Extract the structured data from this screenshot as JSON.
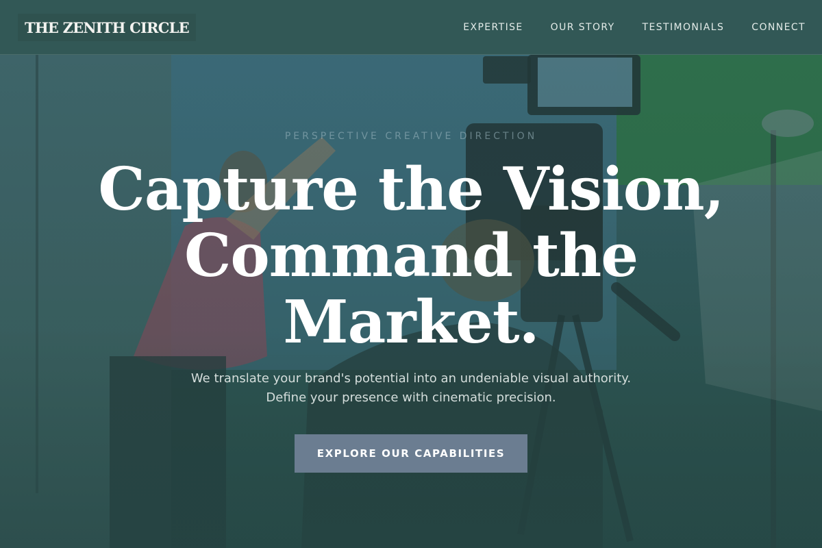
{
  "header": {
    "logo": "THE ZENITH CIRCLE",
    "nav": [
      {
        "label": "EXPERTISE"
      },
      {
        "label": "OUR STORY"
      },
      {
        "label": "TESTIMONIALS"
      },
      {
        "label": "CONNECT"
      }
    ]
  },
  "hero": {
    "eyebrow": "PERSPECTIVE CREATIVE DIRECTION",
    "headline": "Capture the Vision, Command the Market.",
    "subtext_line1": "We translate your brand's potential into an undeniable visual authority.",
    "subtext_line2": "Define your presence with cinematic precision.",
    "cta_label": "EXPLORE OUR CAPABILITIES"
  },
  "colors": {
    "header_bg": "#325856",
    "hero_tint": "#2c4e4c",
    "cta_bg": "#6b7d91",
    "text_light": "#ffffff"
  }
}
